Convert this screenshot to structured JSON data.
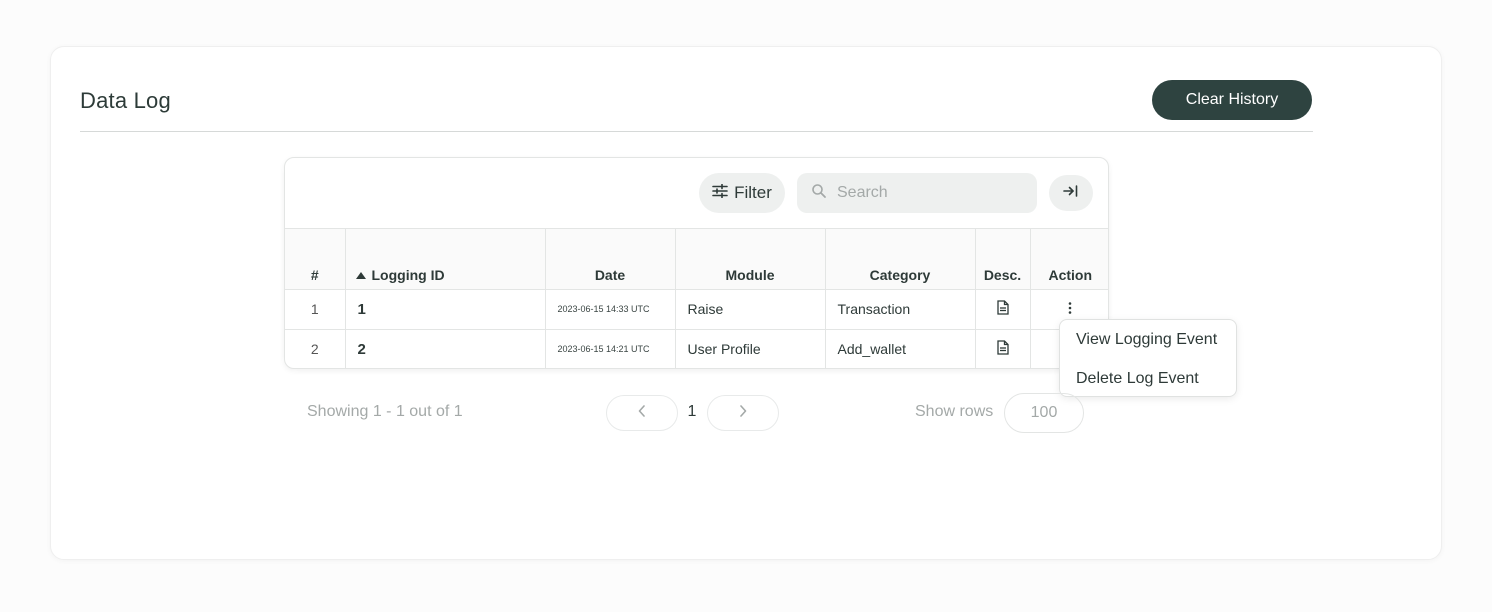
{
  "page": {
    "title": "Data Log",
    "clear_button": "Clear History"
  },
  "toolbar": {
    "filter_label": "Filter",
    "search_placeholder": "Search"
  },
  "table": {
    "columns": [
      "#",
      "Logging ID",
      "Date",
      "Module",
      "Category",
      "Desc.",
      "Action"
    ],
    "sort_column": "Logging ID",
    "sort_direction": "ascending",
    "rows": [
      {
        "index": "1",
        "id": "1",
        "date": "2023-06-15 14:33 UTC",
        "module": "Raise",
        "category": "Transaction"
      },
      {
        "index": "2",
        "id": "2",
        "date": "2023-06-15 14:21 UTC",
        "module": "User Profile",
        "category": "Add_wallet"
      }
    ]
  },
  "action_menu": {
    "items": [
      "View Logging Event",
      "Delete Log Event"
    ]
  },
  "pagination": {
    "summary": "Showing 1 - 1 out of 1",
    "current_page": "1",
    "show_rows_label": "Show rows",
    "rows_per_page": "100"
  },
  "colors": {
    "primary": "#2e4340",
    "muted_text": "#a4a9a8",
    "border": "#e3e5e4"
  }
}
